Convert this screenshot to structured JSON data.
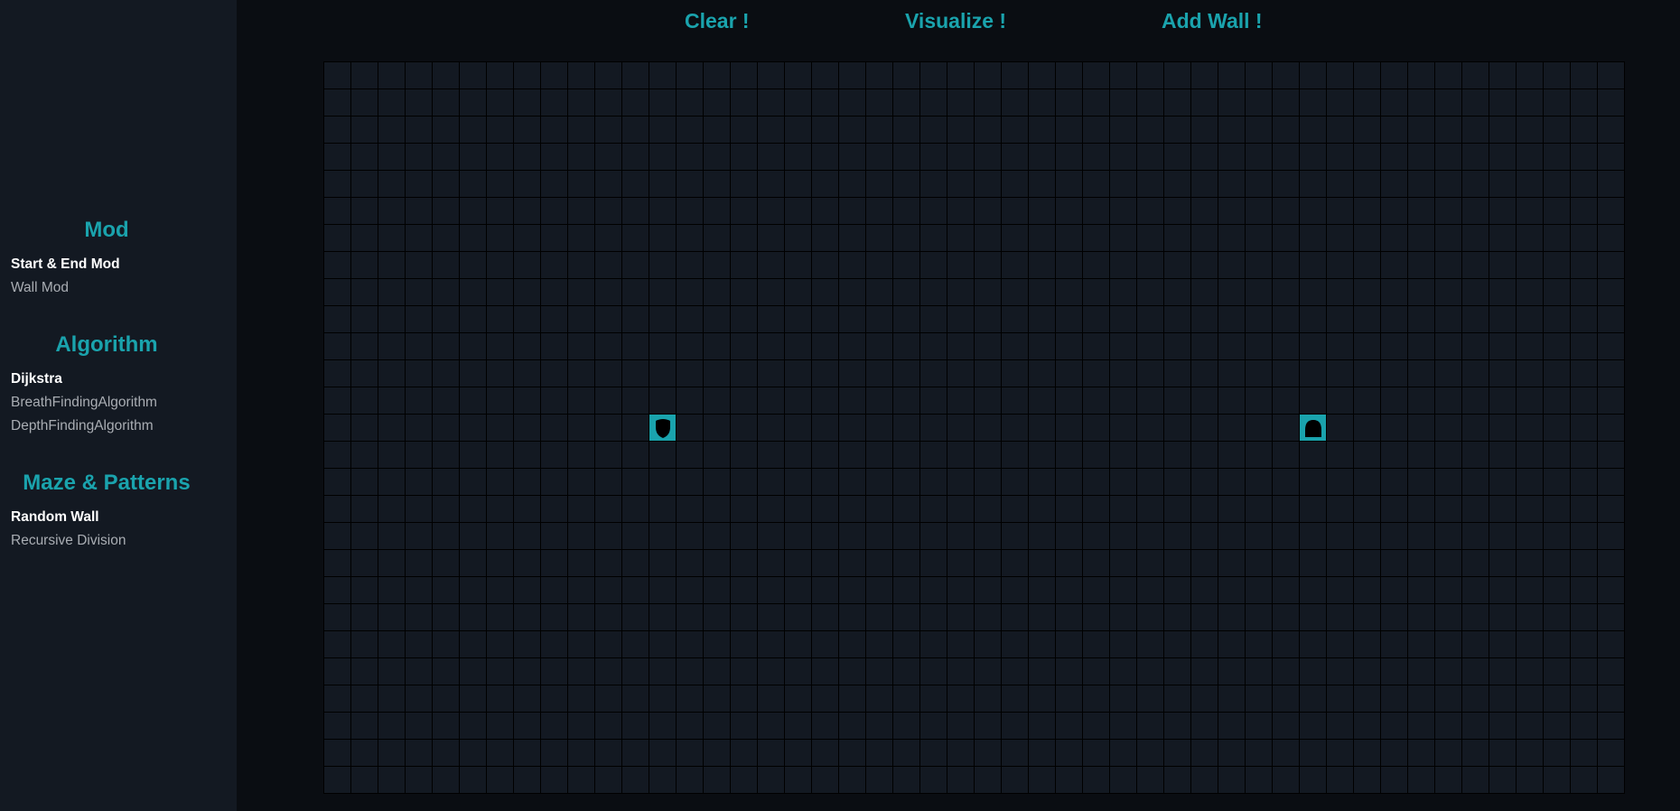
{
  "sidebar": {
    "sections": [
      {
        "title": "Mod",
        "options": [
          "Start & End Mod",
          "Wall Mod"
        ],
        "selected": "Start & End Mod"
      },
      {
        "title": "Algorithm",
        "options": [
          "Dijkstra",
          "BreathFindingAlgorithm",
          "DepthFindingAlgorithm"
        ],
        "selected": "Dijkstra"
      },
      {
        "title": "Maze & Patterns",
        "options": [
          "Random Wall",
          "Recursive Division"
        ],
        "selected": "Random Wall"
      }
    ]
  },
  "actions": {
    "clear_label": "Clear !",
    "visualize_label": "Visualize !",
    "add_wall_label": "Add Wall !"
  },
  "grid": {
    "rows": 27,
    "cols": 48,
    "start": {
      "row": 13,
      "col": 12,
      "icon": "shield-icon"
    },
    "end": {
      "row": 13,
      "col": 36,
      "icon": "dome-icon"
    }
  },
  "colors": {
    "accent": "#1aa3ad",
    "sidebar_bg": "#131922",
    "page_bg": "#0a0d12",
    "cell_bg": "#131922",
    "grid_line": "#000000",
    "active_option": "#ffffff",
    "inactive_option": "#a9adb3"
  }
}
